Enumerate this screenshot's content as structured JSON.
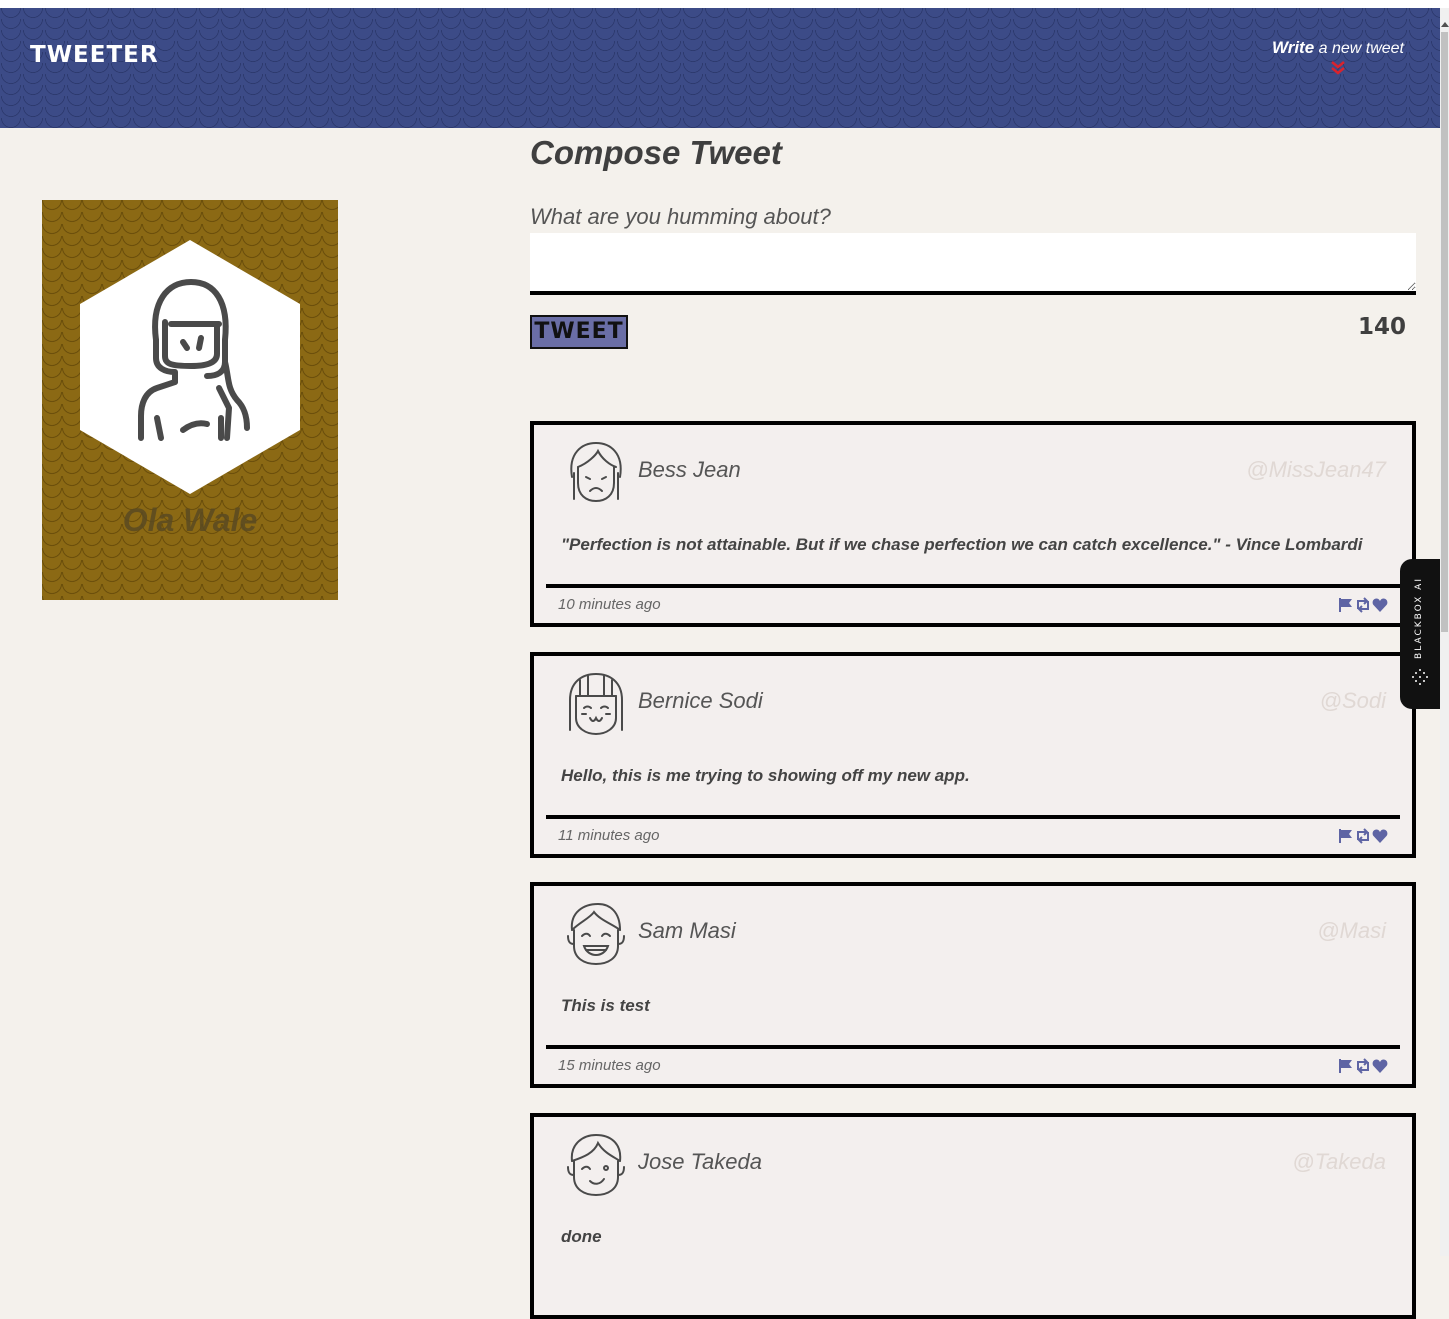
{
  "nav": {
    "brand": "TWEETER",
    "write_bold": "Write",
    "write_rest": " a new tweet"
  },
  "profile": {
    "name": "Ola Wale"
  },
  "compose": {
    "title": "Compose Tweet",
    "label": "What are you humming about?",
    "input_value": "",
    "button_label": "TWEET",
    "counter": "140"
  },
  "tweets": [
    {
      "name": "Bess Jean",
      "handle": "@MissJean47",
      "content": "\"Perfection is not attainable. But if we chase perfection we can catch excellence.\" - Vince Lombardi",
      "time": "10 minutes ago",
      "avatar_icon": "sad-girl-avatar-icon"
    },
    {
      "name": "Bernice Sodi",
      "handle": "@Sodi",
      "content": "Hello, this is me trying to showing off my new app.",
      "time": "11 minutes ago",
      "avatar_icon": "happy-girl-avatar-icon"
    },
    {
      "name": "Sam Masi",
      "handle": "@Masi",
      "content": "This is test",
      "time": "15 minutes ago",
      "avatar_icon": "laughing-boy-avatar-icon"
    },
    {
      "name": "Jose Takeda",
      "handle": "@Takeda",
      "content": "done",
      "time": "",
      "avatar_icon": "winking-boy-avatar-icon"
    }
  ],
  "actions": [
    "flag-icon",
    "retweet-icon",
    "heart-icon"
  ],
  "sidebar_widget": {
    "label": "BLACKBOX AI"
  },
  "colors": {
    "nav_bg": "#3c4b87",
    "profile_bg": "#8b6914",
    "accent": "#6a6ea6",
    "chevron": "#d9232d"
  }
}
